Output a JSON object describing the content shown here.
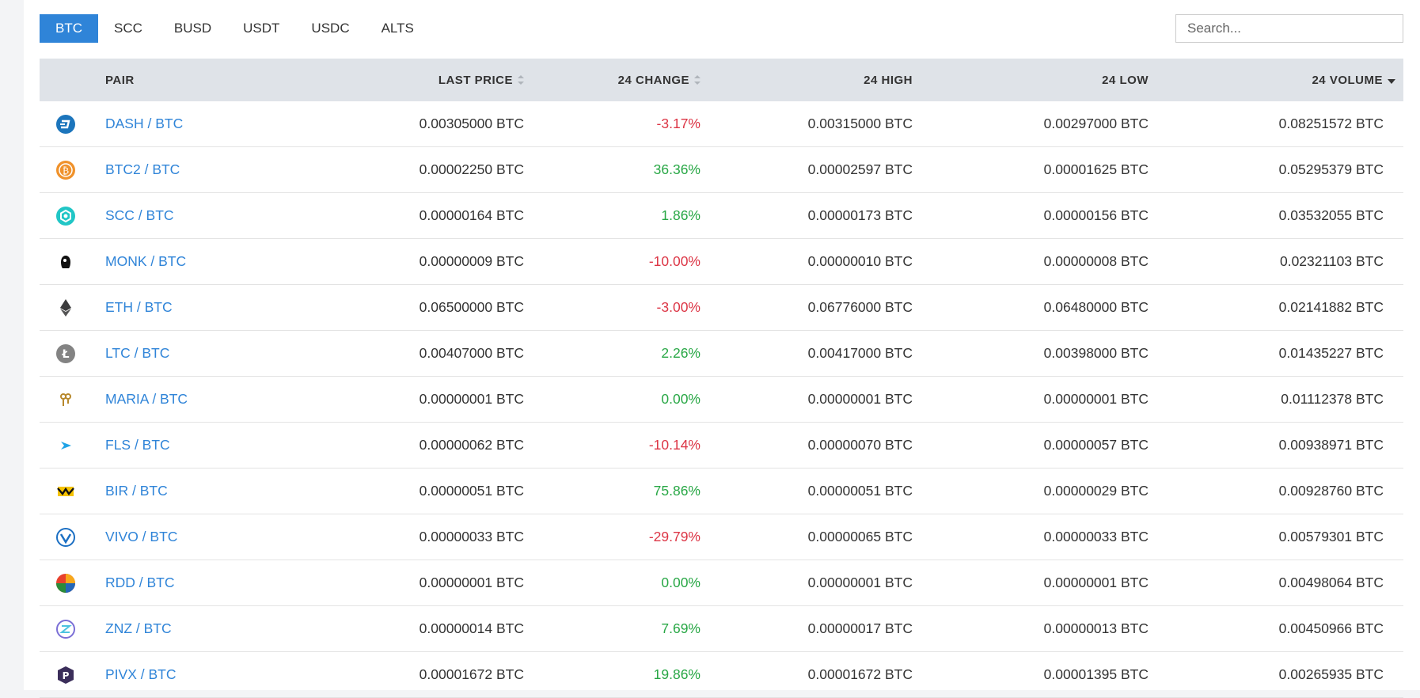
{
  "tabs": [
    "BTC",
    "SCC",
    "BUSD",
    "USDT",
    "USDC",
    "ALTS"
  ],
  "active_tab": "BTC",
  "search": {
    "placeholder": "Search..."
  },
  "columns": {
    "pair": "PAIR",
    "last_price": "LAST PRICE",
    "change": "24 CHANGE",
    "high": "24 HIGH",
    "low": "24 LOW",
    "volume": "24 VOLUME"
  },
  "colors": {
    "accent": "#2f84d8",
    "negative": "#dc3545",
    "positive": "#28a745",
    "header_bg": "#dfe3e8"
  },
  "rows": [
    {
      "icon": "dash-icon",
      "pair": "DASH / BTC",
      "last": "0.00305000 BTC",
      "change": "-3.17%",
      "dir": "neg",
      "high": "0.00315000 BTC",
      "low": "0.00297000 BTC",
      "volume": "0.08251572 BTC"
    },
    {
      "icon": "btc2-icon",
      "pair": "BTC2 / BTC",
      "last": "0.00002250 BTC",
      "change": "36.36%",
      "dir": "pos",
      "high": "0.00002597 BTC",
      "low": "0.00001625 BTC",
      "volume": "0.05295379 BTC"
    },
    {
      "icon": "scc-icon",
      "pair": "SCC / BTC",
      "last": "0.00000164 BTC",
      "change": "1.86%",
      "dir": "pos",
      "high": "0.00000173 BTC",
      "low": "0.00000156 BTC",
      "volume": "0.03532055 BTC"
    },
    {
      "icon": "monk-icon",
      "pair": "MONK / BTC",
      "last": "0.00000009 BTC",
      "change": "-10.00%",
      "dir": "neg",
      "high": "0.00000010 BTC",
      "low": "0.00000008 BTC",
      "volume": "0.02321103 BTC"
    },
    {
      "icon": "eth-icon",
      "pair": "ETH / BTC",
      "last": "0.06500000 BTC",
      "change": "-3.00%",
      "dir": "neg",
      "high": "0.06776000 BTC",
      "low": "0.06480000 BTC",
      "volume": "0.02141882 BTC"
    },
    {
      "icon": "ltc-icon",
      "pair": "LTC / BTC",
      "last": "0.00407000 BTC",
      "change": "2.26%",
      "dir": "pos",
      "high": "0.00417000 BTC",
      "low": "0.00398000 BTC",
      "volume": "0.01435227 BTC"
    },
    {
      "icon": "maria-icon",
      "pair": "MARIA / BTC",
      "last": "0.00000001 BTC",
      "change": "0.00%",
      "dir": "pos",
      "high": "0.00000001 BTC",
      "low": "0.00000001 BTC",
      "volume": "0.01112378 BTC"
    },
    {
      "icon": "fls-icon",
      "pair": "FLS / BTC",
      "last": "0.00000062 BTC",
      "change": "-10.14%",
      "dir": "neg",
      "high": "0.00000070 BTC",
      "low": "0.00000057 BTC",
      "volume": "0.00938971 BTC"
    },
    {
      "icon": "bir-icon",
      "pair": "BIR / BTC",
      "last": "0.00000051 BTC",
      "change": "75.86%",
      "dir": "pos",
      "high": "0.00000051 BTC",
      "low": "0.00000029 BTC",
      "volume": "0.00928760 BTC"
    },
    {
      "icon": "vivo-icon",
      "pair": "VIVO / BTC",
      "last": "0.00000033 BTC",
      "change": "-29.79%",
      "dir": "neg",
      "high": "0.00000065 BTC",
      "low": "0.00000033 BTC",
      "volume": "0.00579301 BTC"
    },
    {
      "icon": "rdd-icon",
      "pair": "RDD / BTC",
      "last": "0.00000001 BTC",
      "change": "0.00%",
      "dir": "pos",
      "high": "0.00000001 BTC",
      "low": "0.00000001 BTC",
      "volume": "0.00498064 BTC"
    },
    {
      "icon": "znz-icon",
      "pair": "ZNZ / BTC",
      "last": "0.00000014 BTC",
      "change": "7.69%",
      "dir": "pos",
      "high": "0.00000017 BTC",
      "low": "0.00000013 BTC",
      "volume": "0.00450966 BTC"
    },
    {
      "icon": "pivx-icon",
      "pair": "PIVX / BTC",
      "last": "0.00001672 BTC",
      "change": "19.86%",
      "dir": "pos",
      "high": "0.00001672 BTC",
      "low": "0.00001395 BTC",
      "volume": "0.00265935 BTC"
    }
  ]
}
